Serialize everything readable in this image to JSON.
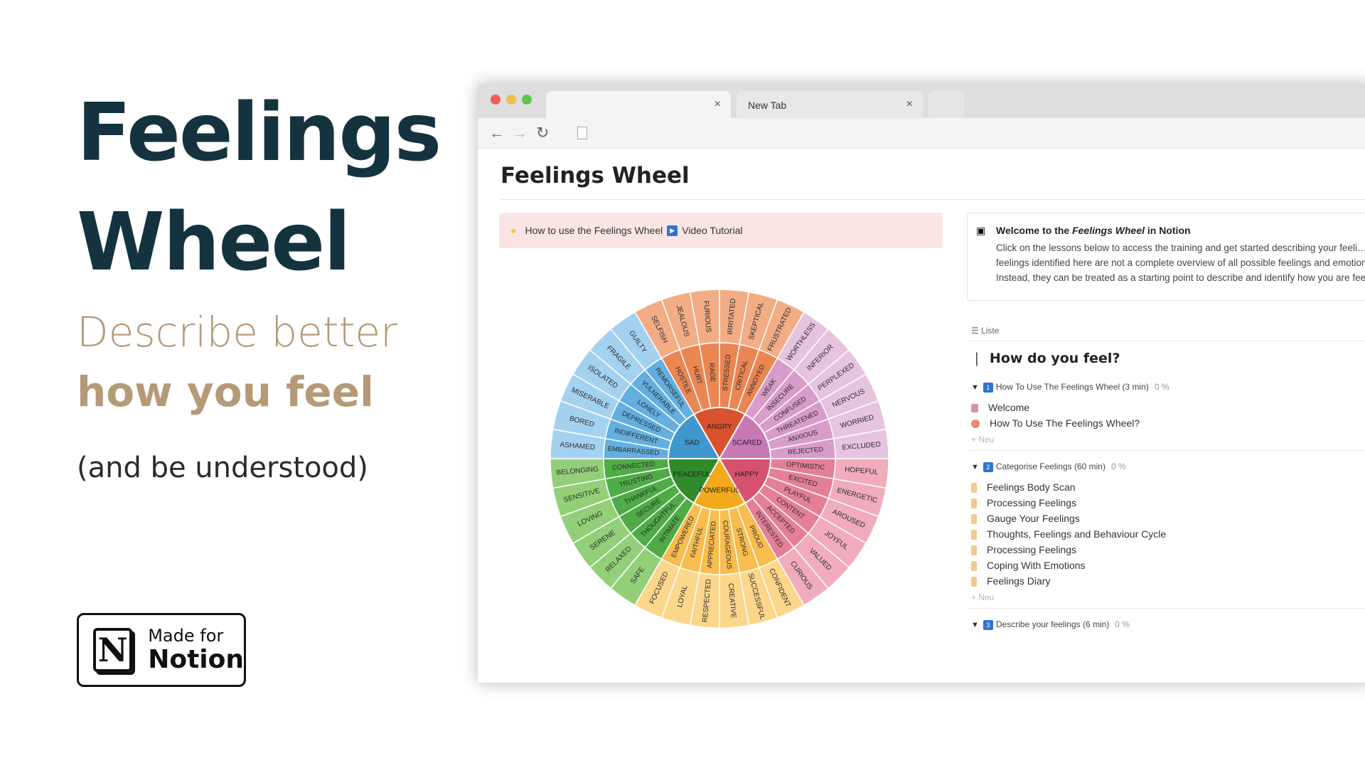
{
  "promo": {
    "title_line1": "Feelings",
    "title_line2": "Wheel",
    "subtitle_line1": "Describe better",
    "subtitle_line2": "how you feel",
    "note": "(and be understood)",
    "badge_small": "Made for",
    "badge_big": "Notion",
    "badge_logo_letter": "N",
    "colors": {
      "title": "#14333f",
      "accent": "#b59a78"
    }
  },
  "browser": {
    "tab_active_close": "×",
    "tab_inactive_label": "New Tab",
    "tab_inactive_close": "×",
    "nav_back": "←",
    "nav_forward": "→",
    "nav_reload": "↻"
  },
  "page": {
    "title": "Feelings Wheel",
    "callout": {
      "icon": "lightbulb-icon",
      "text": "How to use the Feelings Wheel",
      "play_icon": "▶",
      "link": "Video Tutorial"
    },
    "welcome": {
      "icon": "notion-page-icon",
      "head_pre": "Welcome to the",
      "head_em": "Feelings Wheel",
      "head_post": "in Notion",
      "body": "Click on the lessons below to access the training and get started describing your feeli… The feelings identified here are not a complete overview of all possible feelings and emotions. Instead, they can be treated as a starting point to describe and identify how you are feeling."
    },
    "view_label": "Liste",
    "question": "How do you feel?",
    "groups": [
      {
        "num": "1",
        "title": "How To Use The Feelings Wheel (3 min)",
        "pct": "0 %",
        "items": [
          "Welcome",
          "How To Use The Feelings Wheel?"
        ],
        "add": "+ Neu"
      },
      {
        "num": "2",
        "title": "Categorise Feelings (60 min)",
        "pct": "0 %",
        "items": [
          "Feelings Body Scan",
          "Processing Feelings",
          "Gauge Your Feelings",
          "Thoughts, Feelings and Behaviour Cycle",
          "Processing Feelings",
          "Coping With Emotions",
          "Feelings Diary"
        ],
        "add": "+ Neu"
      },
      {
        "num": "3",
        "title": "Describe your feelings (6 min)",
        "pct": "0 %"
      }
    ]
  },
  "wheel": {
    "core": [
      {
        "name": "ANGRY",
        "color": "#d9522d"
      },
      {
        "name": "SCARED",
        "color": "#c978b6"
      },
      {
        "name": "HAPPY",
        "color": "#d6506f"
      },
      {
        "name": "POWERFUL",
        "color": "#f4a91c"
      },
      {
        "name": "PEACEFUL",
        "color": "#2f8a2c"
      },
      {
        "name": "SAD",
        "color": "#3e97cf"
      }
    ],
    "middle": [
      {
        "name": "HOSTILE",
        "core": 0
      },
      {
        "name": "HURT",
        "core": 0
      },
      {
        "name": "RAGE",
        "core": 0
      },
      {
        "name": "STRESSED",
        "core": 0
      },
      {
        "name": "CRITICAL",
        "core": 0
      },
      {
        "name": "ANNOYED",
        "core": 0
      },
      {
        "name": "WEAK",
        "core": 1
      },
      {
        "name": "INSECURE",
        "core": 1
      },
      {
        "name": "CONFUSED",
        "core": 1
      },
      {
        "name": "THREATENED",
        "core": 1
      },
      {
        "name": "ANXIOUS",
        "core": 1
      },
      {
        "name": "REJECTED",
        "core": 1
      },
      {
        "name": "OPTIMISTIC",
        "core": 2
      },
      {
        "name": "EXCITED",
        "core": 2
      },
      {
        "name": "PLAYFUL",
        "core": 2
      },
      {
        "name": "CONTENT",
        "core": 2
      },
      {
        "name": "ACCEPTED",
        "core": 2
      },
      {
        "name": "INTERESTED",
        "core": 2
      },
      {
        "name": "PROUD",
        "core": 3
      },
      {
        "name": "STRONG",
        "core": 3
      },
      {
        "name": "COURAGEOUS",
        "core": 3
      },
      {
        "name": "APPRECIATED",
        "core": 3
      },
      {
        "name": "FAITHFUL",
        "core": 3
      },
      {
        "name": "EMPOWERED",
        "core": 3
      },
      {
        "name": "INTIMATE",
        "core": 4
      },
      {
        "name": "THOUGHTFUL",
        "core": 4
      },
      {
        "name": "SECURE",
        "core": 4
      },
      {
        "name": "THANKFUL",
        "core": 4
      },
      {
        "name": "TRUSTING",
        "core": 4
      },
      {
        "name": "CONNECTED",
        "core": 4
      },
      {
        "name": "EMBARRASSED",
        "core": 5
      },
      {
        "name": "INDIFFERENT",
        "core": 5
      },
      {
        "name": "DEPRESSED",
        "core": 5
      },
      {
        "name": "LONELY",
        "core": 5
      },
      {
        "name": "VULNERABLE",
        "core": 5
      },
      {
        "name": "REMORSEFUL",
        "core": 5
      }
    ],
    "outer": [
      {
        "name": "SELFISH",
        "core": 0
      },
      {
        "name": "JEALOUS",
        "core": 0
      },
      {
        "name": "FURIOUS",
        "core": 0
      },
      {
        "name": "IRRITATED",
        "core": 0
      },
      {
        "name": "SKEPTICAL",
        "core": 0
      },
      {
        "name": "FRUSTRATED",
        "core": 0
      },
      {
        "name": "WORTHLESS",
        "core": 1
      },
      {
        "name": "INFERIOR",
        "core": 1
      },
      {
        "name": "PERPLEXED",
        "core": 1
      },
      {
        "name": "NERVOUS",
        "core": 1
      },
      {
        "name": "WORRIED",
        "core": 1
      },
      {
        "name": "EXCLUDED",
        "core": 1
      },
      {
        "name": "HOPEFUL",
        "core": 2
      },
      {
        "name": "ENERGETIC",
        "core": 2
      },
      {
        "name": "AROUSED",
        "core": 2
      },
      {
        "name": "JOYFUL",
        "core": 2
      },
      {
        "name": "VALUED",
        "core": 2
      },
      {
        "name": "CURIOUS",
        "core": 2
      },
      {
        "name": "CONFIDENT",
        "core": 3
      },
      {
        "name": "SUCCESSFUL",
        "core": 3
      },
      {
        "name": "CREATIVE",
        "core": 3
      },
      {
        "name": "RESPECTED",
        "core": 3
      },
      {
        "name": "LOYAL",
        "core": 3
      },
      {
        "name": "FOCUSED",
        "core": 3
      },
      {
        "name": "SAFE",
        "core": 4
      },
      {
        "name": "RELAXED",
        "core": 4
      },
      {
        "name": "SERENE",
        "core": 4
      },
      {
        "name": "LOVING",
        "core": 4
      },
      {
        "name": "SENSITIVE",
        "core": 4
      },
      {
        "name": "BELONGING",
        "core": 4
      },
      {
        "name": "ASHAMED",
        "core": 5
      },
      {
        "name": "BORED",
        "core": 5
      },
      {
        "name": "MISERABLE",
        "core": 5
      },
      {
        "name": "ISOLATED",
        "core": 5
      },
      {
        "name": "FRAGILE",
        "core": 5
      },
      {
        "name": "GUILTY",
        "core": 5
      }
    ],
    "middle_colors": [
      "#eb8552",
      "#d89ccb",
      "#e57f96",
      "#f8bd4e",
      "#4fab46",
      "#63afe0"
    ],
    "outer_colors": [
      "#f2ad85",
      "#e6c3df",
      "#f0acbc",
      "#fcd68b",
      "#93cf79",
      "#a5d1f0"
    ]
  }
}
